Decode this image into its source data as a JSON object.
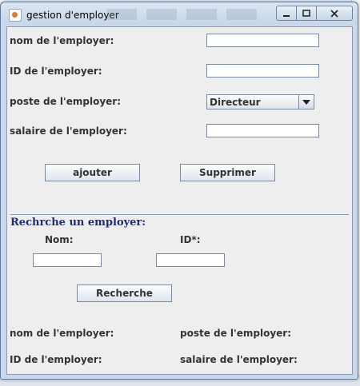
{
  "window": {
    "title": "gestion d'employer"
  },
  "form": {
    "name_label": "nom de l'employer:",
    "id_label": "ID de l'employer:",
    "poste_label": "poste de l'employer:",
    "poste_value": "Directeur",
    "salaire_label": "salaire de l'employer:",
    "name_value": "",
    "id_value": "",
    "salaire_value": ""
  },
  "actions": {
    "add_label": "ajouter",
    "delete_label": "Supprimer"
  },
  "search": {
    "title": "Rechrche un employer:",
    "nom_label": "Nom:",
    "id_label": "ID*:",
    "nom_value": "",
    "id_value": "",
    "button_label": "Recherche"
  },
  "results": {
    "name_label": "nom de l'employer:",
    "poste_label": "poste de l'employer:",
    "id_label": "ID de l'employer:",
    "salaire_label": "salaire de l'employer:"
  }
}
